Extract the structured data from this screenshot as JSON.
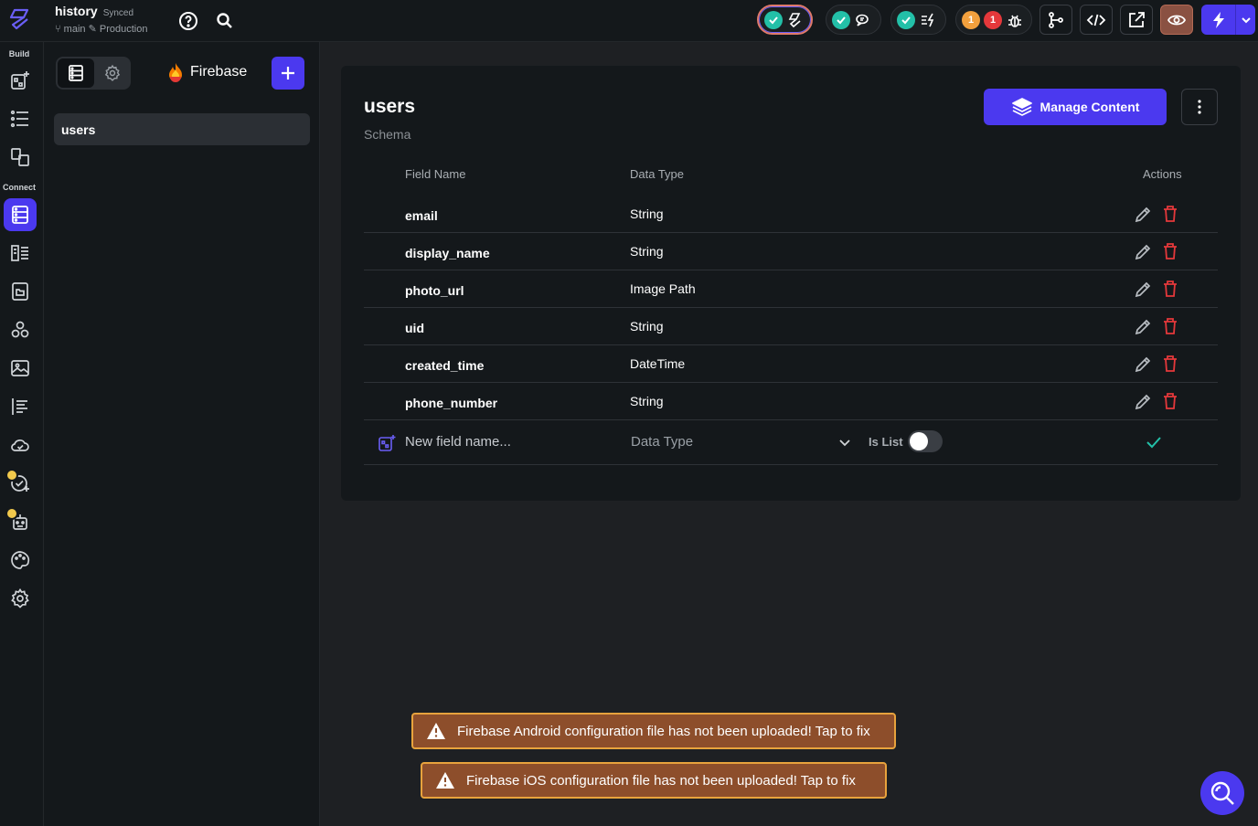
{
  "header": {
    "project_name": "history",
    "sync_status": "Synced",
    "branch": "main",
    "environment": "Production",
    "alert_counts": {
      "warnings": "1",
      "errors": "1"
    }
  },
  "rail": {
    "build_label": "Build",
    "connect_label": "Connect"
  },
  "panel": {
    "provider": "Firebase",
    "collections": [
      "users"
    ]
  },
  "collection": {
    "title": "users",
    "subtitle": "Schema",
    "manage_label": "Manage Content",
    "columns": {
      "field": "Field Name",
      "type": "Data Type",
      "actions": "Actions"
    },
    "fields": [
      {
        "name": "email",
        "type": "String"
      },
      {
        "name": "display_name",
        "type": "String"
      },
      {
        "name": "photo_url",
        "type": "Image Path"
      },
      {
        "name": "uid",
        "type": "String"
      },
      {
        "name": "created_time",
        "type": "DateTime"
      },
      {
        "name": "phone_number",
        "type": "String"
      }
    ],
    "new_field": {
      "placeholder": "New field name...",
      "type_placeholder": "Data Type",
      "is_list_label": "Is List"
    }
  },
  "banners": {
    "android": "Firebase Android configuration file has not been uploaded! Tap to fix",
    "ios": "Firebase iOS configuration file has not been uploaded! Tap to fix"
  },
  "colors": {
    "accent": "#4b39ef",
    "success": "#23c0a8",
    "danger": "#e5383b",
    "warning_border": "#e8a33d"
  }
}
